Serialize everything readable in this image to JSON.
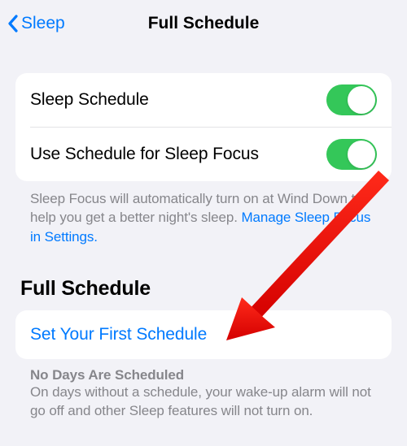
{
  "nav": {
    "back_label": "Sleep",
    "title": "Full Schedule"
  },
  "section1": {
    "row1_label": "Sleep Schedule",
    "row2_label": "Use Schedule for Sleep Focus",
    "footer_text": "Sleep Focus will automatically turn on at Wind Down to help you get a better night's sleep. ",
    "footer_link": "Manage Sleep Focus in Settings."
  },
  "section2": {
    "header": "Full Schedule",
    "row1_label": "Set Your First Schedule",
    "footer_title": "No Days Are Scheduled",
    "footer_body": "On days without a schedule, your wake-up alarm will not go off and other Sleep features will not turn on."
  },
  "toggles": {
    "sleep_schedule": true,
    "use_schedule_for_focus": true
  }
}
